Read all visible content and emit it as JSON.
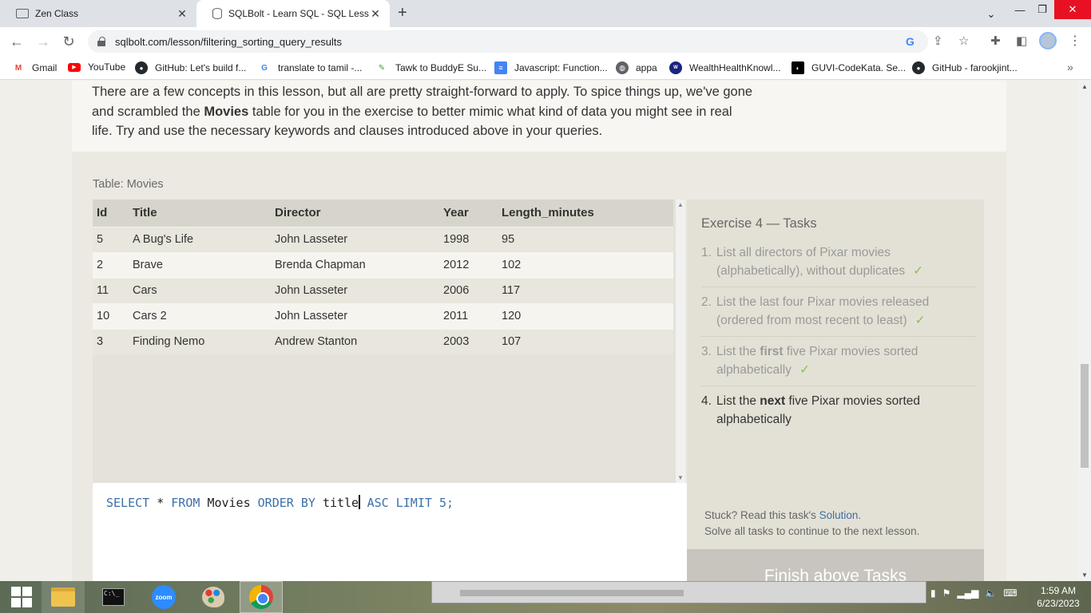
{
  "browser": {
    "tabs": [
      {
        "title": "Zen Class",
        "icon": "zen-class-favicon"
      },
      {
        "title": "SQLBolt - Learn SQL - SQL Lesson",
        "icon": "sqlbolt-favicon",
        "active": true
      }
    ],
    "url": "sqlbolt.com/lesson/filtering_sorting_query_results",
    "bookmarks": [
      {
        "label": "Gmail",
        "icon": "gmail-icon",
        "color": "#ea4335"
      },
      {
        "label": "YouTube",
        "icon": "youtube-icon",
        "color": "#ff0000"
      },
      {
        "label": "GitHub: Let's build f...",
        "icon": "github-icon",
        "color": "#24292e"
      },
      {
        "label": "translate to tamil -...",
        "icon": "google-icon",
        "color": "#4285f4"
      },
      {
        "label": "Tawk to BuddyE Su...",
        "icon": "tawk-icon",
        "color": "#43a047"
      },
      {
        "label": "Javascript: Function...",
        "icon": "docs-icon",
        "color": "#4285f4"
      },
      {
        "label": "appa",
        "icon": "globe-icon",
        "color": "#5f6368"
      },
      {
        "label": "WealthHealthKnowl...",
        "icon": "wealth-icon",
        "color": "#1a237e"
      },
      {
        "label": "GUVI-CodeKata. Se...",
        "icon": "guvi-icon",
        "color": "#000000"
      },
      {
        "label": "GitHub - farookjint...",
        "icon": "github-icon",
        "color": "#24292e"
      }
    ]
  },
  "lesson": {
    "intro_pre": "There are a few concepts in this lesson, but all are pretty straight-forward to apply. To spice things up, we've gone and scrambled the ",
    "intro_bold": "Movies",
    "intro_post": " table for you in the exercise to better mimic what kind of data you might see in real life. Try and use the necessary keywords and clauses introduced above in your queries."
  },
  "table": {
    "label": "Table: Movies",
    "columns": [
      "Id",
      "Title",
      "Director",
      "Year",
      "Length_minutes"
    ],
    "rows": [
      [
        "5",
        "A Bug's Life",
        "John Lasseter",
        "1998",
        "95"
      ],
      [
        "2",
        "Brave",
        "Brenda Chapman",
        "2012",
        "102"
      ],
      [
        "11",
        "Cars",
        "John Lasseter",
        "2006",
        "117"
      ],
      [
        "10",
        "Cars 2",
        "John Lasseter",
        "2011",
        "120"
      ],
      [
        "3",
        "Finding Nemo",
        "Andrew Stanton",
        "2003",
        "107"
      ]
    ]
  },
  "editor": {
    "kw_select": "SELECT",
    "star": "*",
    "kw_from": "FROM",
    "table": "Movies",
    "kw_order": "ORDER BY",
    "column": "title",
    "kw_asc": "ASC",
    "kw_limit": "LIMIT",
    "limit_value": "5;"
  },
  "exercise": {
    "title": "Exercise 4 — Tasks",
    "tasks": [
      {
        "num": "1.",
        "pre": "List all directors of Pixar movies (alphabetically), without duplicates",
        "bold": "",
        "post": "",
        "done": true
      },
      {
        "num": "2.",
        "pre": "List the last four Pixar movies released (ordered from most recent to least)",
        "bold": "",
        "post": "",
        "done": true
      },
      {
        "num": "3.",
        "pre": "List the ",
        "bold": "first",
        "post": " five Pixar movies sorted alphabetically",
        "done": true
      },
      {
        "num": "4.",
        "pre": "List the ",
        "bold": "next",
        "post": " five Pixar movies sorted alphabetically",
        "done": false
      }
    ],
    "check_glyph": "✓",
    "stuck_pre": "Stuck? Read this task's ",
    "stuck_link": "Solution",
    "stuck_post": ".",
    "solve_text": "Solve all tasks to continue to the next lesson.",
    "finish_label": "Finish above Tasks"
  },
  "taskbar": {
    "apps": [
      "start-menu",
      "file-explorer",
      "command-prompt",
      "zoom",
      "paint",
      "chrome"
    ],
    "zoom_label": "zoom",
    "cmd_label": "C:\\_",
    "time": "1:59 AM",
    "date": "6/23/2023"
  }
}
